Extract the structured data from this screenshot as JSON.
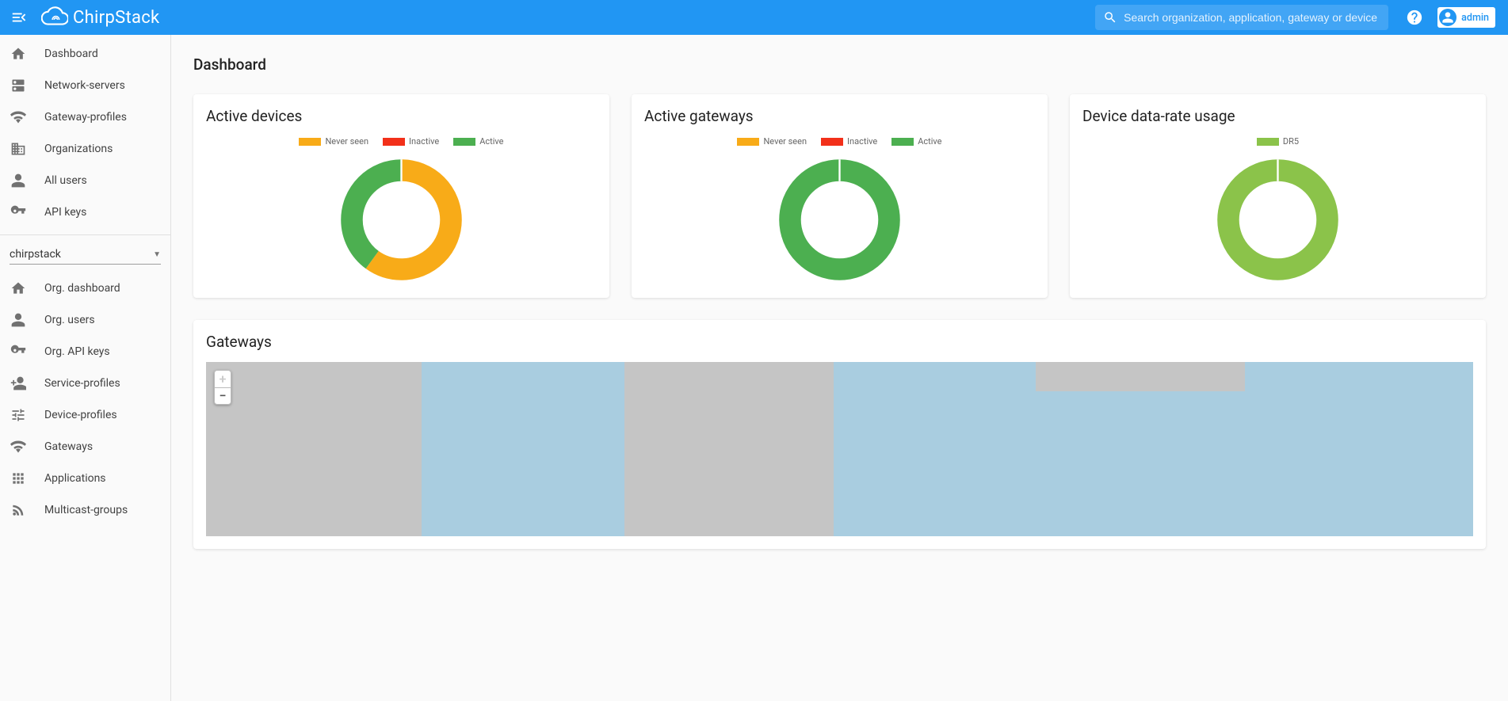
{
  "brand": "ChirpStack",
  "search": {
    "placeholder": "Search organization, application, gateway or device"
  },
  "user": {
    "name": "admin"
  },
  "sidebar": {
    "global": [
      {
        "id": "dashboard",
        "label": "Dashboard",
        "icon": "home"
      },
      {
        "id": "network-servers",
        "label": "Network-servers",
        "icon": "dns"
      },
      {
        "id": "gateway-profiles",
        "label": "Gateway-profiles",
        "icon": "wifi"
      },
      {
        "id": "organizations",
        "label": "Organizations",
        "icon": "domain"
      },
      {
        "id": "all-users",
        "label": "All users",
        "icon": "person"
      },
      {
        "id": "api-keys",
        "label": "API keys",
        "icon": "key"
      }
    ],
    "org_selector": "chirpstack",
    "org": [
      {
        "id": "org-dashboard",
        "label": "Org. dashboard",
        "icon": "home"
      },
      {
        "id": "org-users",
        "label": "Org. users",
        "icon": "person"
      },
      {
        "id": "org-api-keys",
        "label": "Org. API keys",
        "icon": "key"
      },
      {
        "id": "service-profiles",
        "label": "Service-profiles",
        "icon": "person-add"
      },
      {
        "id": "device-profiles",
        "label": "Device-profiles",
        "icon": "tune"
      },
      {
        "id": "gateways",
        "label": "Gateways",
        "icon": "wifi"
      },
      {
        "id": "applications",
        "label": "Applications",
        "icon": "apps"
      },
      {
        "id": "multicast-groups",
        "label": "Multicast-groups",
        "icon": "rss"
      }
    ]
  },
  "page_title": "Dashboard",
  "colors": {
    "never_seen": "#f8ab18",
    "inactive": "#f2301a",
    "active": "#4caf50",
    "dr5": "#8bc34a"
  },
  "cards": {
    "active_devices": {
      "title": "Active devices",
      "legend": [
        "Never seen",
        "Inactive",
        "Active"
      ]
    },
    "active_gateways": {
      "title": "Active gateways",
      "legend": [
        "Never seen",
        "Inactive",
        "Active"
      ]
    },
    "data_rate": {
      "title": "Device data-rate usage",
      "legend": [
        "DR5"
      ]
    }
  },
  "map_card": {
    "title": "Gateways"
  },
  "chart_data": [
    {
      "type": "pie",
      "title": "Active devices",
      "series": [
        {
          "name": "Never seen",
          "value": 60,
          "color": "#f8ab18"
        },
        {
          "name": "Inactive",
          "value": 0,
          "color": "#f2301a"
        },
        {
          "name": "Active",
          "value": 40,
          "color": "#4caf50"
        }
      ]
    },
    {
      "type": "pie",
      "title": "Active gateways",
      "series": [
        {
          "name": "Never seen",
          "value": 0,
          "color": "#f8ab18"
        },
        {
          "name": "Inactive",
          "value": 0,
          "color": "#f2301a"
        },
        {
          "name": "Active",
          "value": 100,
          "color": "#4caf50"
        }
      ]
    },
    {
      "type": "pie",
      "title": "Device data-rate usage",
      "series": [
        {
          "name": "DR5",
          "value": 100,
          "color": "#8bc34a"
        }
      ]
    }
  ]
}
